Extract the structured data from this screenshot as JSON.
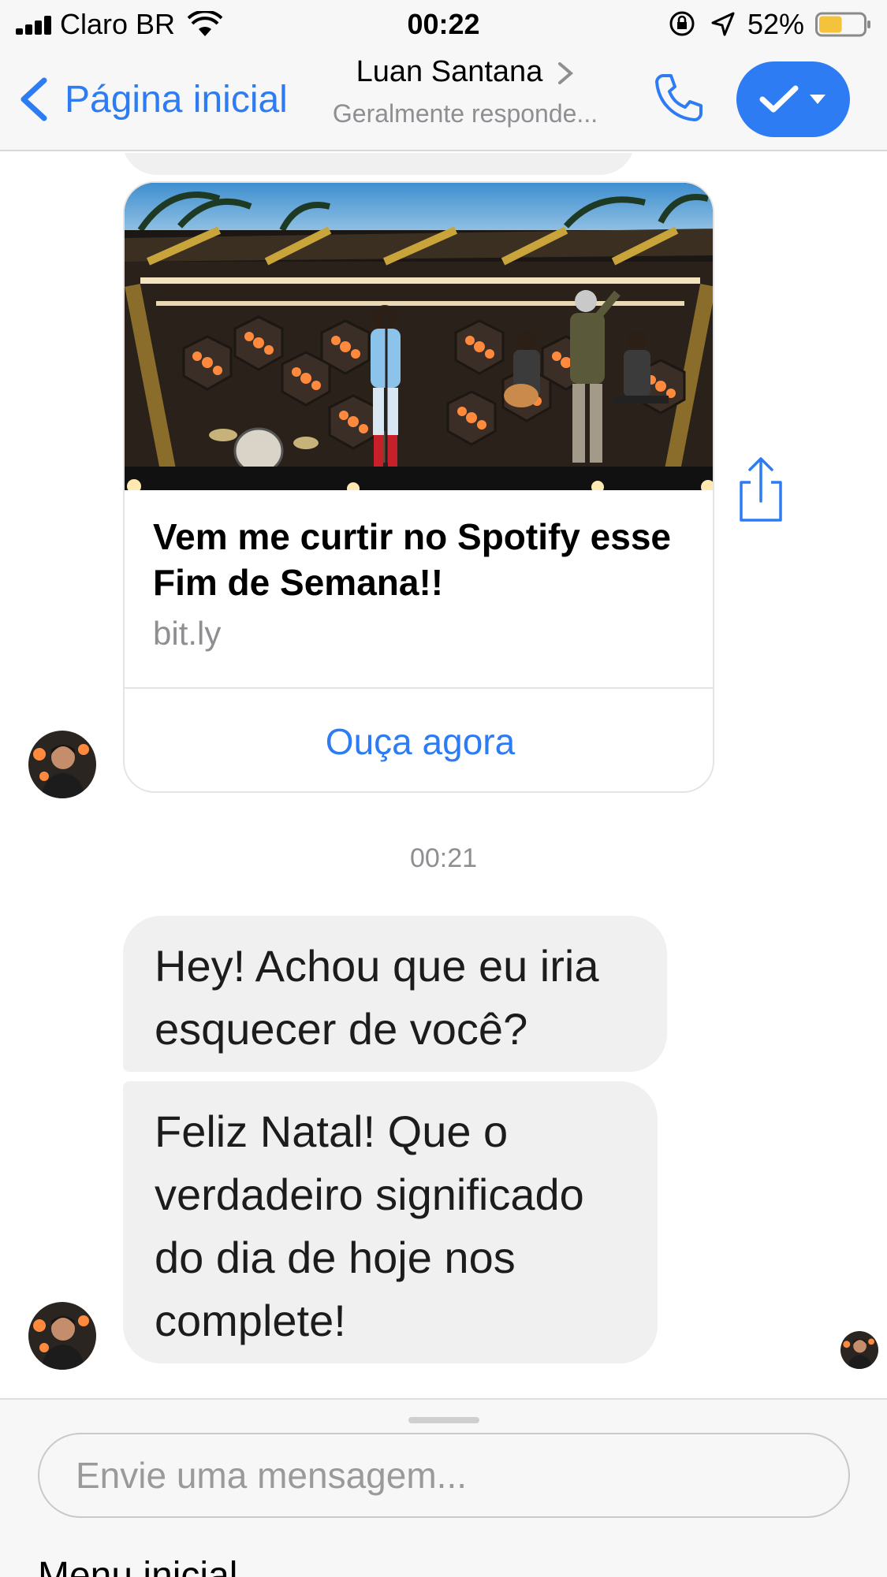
{
  "status_bar": {
    "carrier": "Claro BR",
    "time": "00:22",
    "battery_percent": "52%",
    "battery_level": 0.52
  },
  "nav": {
    "back_label": "Página inicial",
    "title": "Luan Santana",
    "subtitle": "Geralmente responde...",
    "accent_color": "#2d7cf3"
  },
  "link_card": {
    "title": "Vem me curtir no Spotify esse Fim de Semana!!",
    "domain": "bit.ly",
    "action_label": "Ouça agora"
  },
  "timestamp": "00:21",
  "messages": [
    {
      "text": "Hey! Achou que eu iria esquecer de você?"
    },
    {
      "text": "Feliz Natal! Que o verdadeiro significado do dia de hoje nos complete!"
    }
  ],
  "composer": {
    "placeholder": "Envie uma mensagem...",
    "menu_label": "Menu inicial"
  }
}
